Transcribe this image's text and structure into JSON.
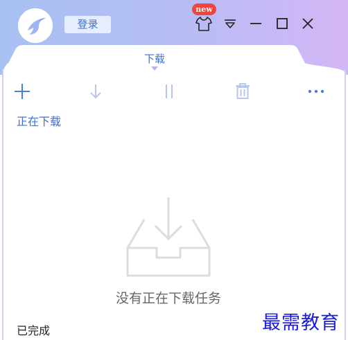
{
  "header": {
    "login_label": "登录",
    "new_badge": "new"
  },
  "tab": {
    "label": "下载"
  },
  "toolbar": {
    "items": [
      "add-icon",
      "download-icon",
      "pause-icon",
      "delete-icon",
      "more-icon"
    ]
  },
  "sections": {
    "downloading_label": "正在下载",
    "completed_label": "已完成"
  },
  "empty_state": {
    "message": "没有正在下载任务"
  },
  "watermark": "最需教育",
  "colors": {
    "accent": "#3d6fd9",
    "header_gradient_start": "#a8c0f2",
    "header_gradient_end": "#d4b6f6",
    "badge": "#f0453a",
    "icon_muted": "#b9c7ee",
    "watermark": "#1a1ad8"
  }
}
